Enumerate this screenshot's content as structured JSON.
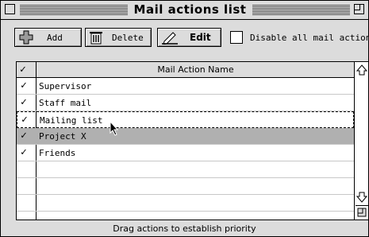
{
  "window": {
    "title": "Mail actions list"
  },
  "toolbar": {
    "add_label": "Add",
    "delete_label": "Delete",
    "edit_label": "Edit",
    "disable_label": "Disable all mail actions",
    "disable_checked": false
  },
  "list": {
    "check_header": "✓",
    "column_header": "Mail Action Name",
    "rows": [
      {
        "check": "✓",
        "name": "Supervisor"
      },
      {
        "check": "✓",
        "name": "Staff mail"
      },
      {
        "check": "✓",
        "name": "Mailing list"
      },
      {
        "check": "✓",
        "name": "Project X"
      },
      {
        "check": "✓",
        "name": "Friends"
      }
    ]
  },
  "status": {
    "text": "Drag actions to establish priority"
  },
  "icons": {
    "add": "plus-icon",
    "delete": "trash-icon",
    "edit": "pencil-icon",
    "close": "close-box-icon",
    "zoom": "zoom-box-icon",
    "scroll_up": "arrow-up-icon",
    "scroll_down": "arrow-down-icon",
    "resize": "grow-box-icon",
    "cursor": "arrow-cursor-icon"
  },
  "colors": {
    "window_bg": "#dcdcdc",
    "selected_row": "#b0b0b0",
    "list_bg": "#ffffff"
  }
}
